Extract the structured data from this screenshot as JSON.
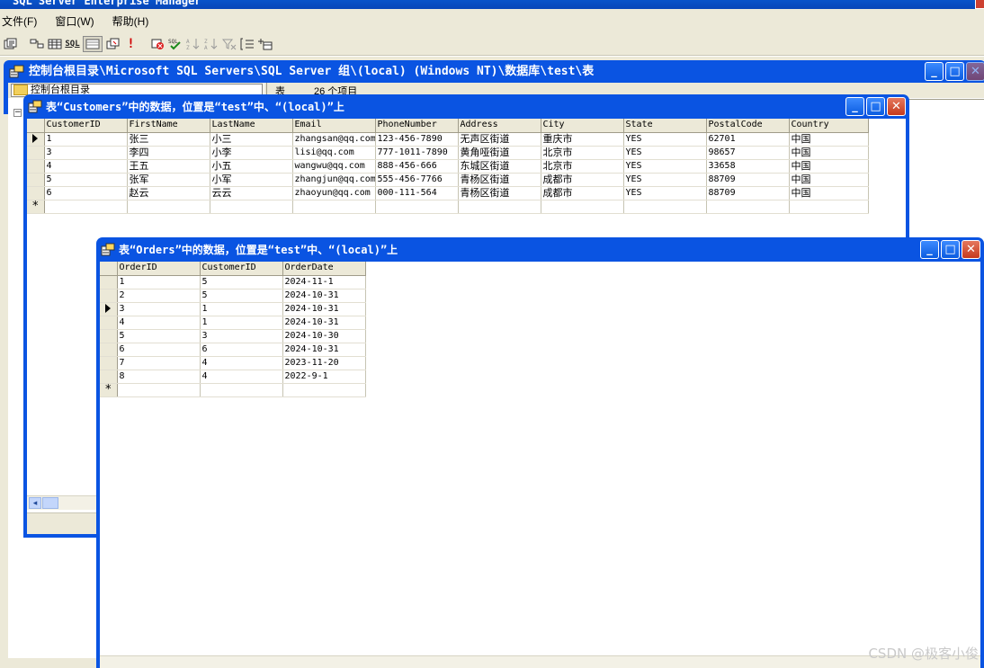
{
  "app": {
    "title": "SQL Server Enterprise Manager"
  },
  "menu": {
    "file": "文件(F)",
    "window": "窗口(W)",
    "help": "帮助(H)"
  },
  "toolbar": {
    "sql_label": "SQL"
  },
  "console": {
    "title": "控制台根目录\\Microsoft SQL Servers\\SQL Server 组\\(local) (Windows NT)\\数据库\\test\\表",
    "tree_root": "控制台根目录",
    "list_label": "表",
    "item_count": "26 个项目"
  },
  "customers_window": {
    "title": "表“Customers”中的数据，位置是“test”中、“(local)”上",
    "columns": [
      "CustomerID",
      "FirstName",
      "LastName",
      "Email",
      "PhoneNumber",
      "Address",
      "City",
      "State",
      "PostalCode",
      "Country"
    ],
    "rows": [
      [
        "1",
        "张三",
        "小三",
        "zhangsan@qq.com",
        "123-456-7890",
        "无声区街道",
        "重庆市",
        "YES",
        "62701",
        "中国"
      ],
      [
        "3",
        "李四",
        "小李",
        "lisi@qq.com",
        "777-1011-7890",
        "黄角哑街道",
        "北京市",
        "YES",
        "98657",
        "中国"
      ],
      [
        "4",
        "王五",
        "小五",
        "wangwu@qq.com",
        "888-456-666",
        "东城区街道",
        "北京市",
        "YES",
        "33658",
        "中国"
      ],
      [
        "5",
        "张军",
        "小军",
        "zhangjun@qq.com",
        "555-456-7766",
        "青杨区街道",
        "成都市",
        "YES",
        "88709",
        "中国"
      ],
      [
        "6",
        "赵云",
        "云云",
        "zhaoyun@qq.com",
        "000-111-564",
        "青杨区街道",
        "成都市",
        "YES",
        "88709",
        "中国"
      ]
    ],
    "current_row": 0
  },
  "orders_window": {
    "title": "表“Orders”中的数据，位置是“test”中、“(local)”上",
    "columns": [
      "OrderID",
      "CustomerID",
      "OrderDate"
    ],
    "rows": [
      [
        "1",
        "5",
        "2024-11-1"
      ],
      [
        "2",
        "5",
        "2024-10-31"
      ],
      [
        "3",
        "1",
        "2024-10-31"
      ],
      [
        "4",
        "1",
        "2024-10-31"
      ],
      [
        "5",
        "3",
        "2024-10-30"
      ],
      [
        "6",
        "6",
        "2024-10-31"
      ],
      [
        "7",
        "4",
        "2023-11-20"
      ],
      [
        "8",
        "4",
        "2022-9-1"
      ]
    ],
    "current_row": 2
  },
  "new_row_marker": "*",
  "watermark": "CSDN @极客小俊",
  "colors": {
    "titlebar_blue": "#0a54e2",
    "chrome": "#ece9d8",
    "close_red": "#c53a1e"
  }
}
